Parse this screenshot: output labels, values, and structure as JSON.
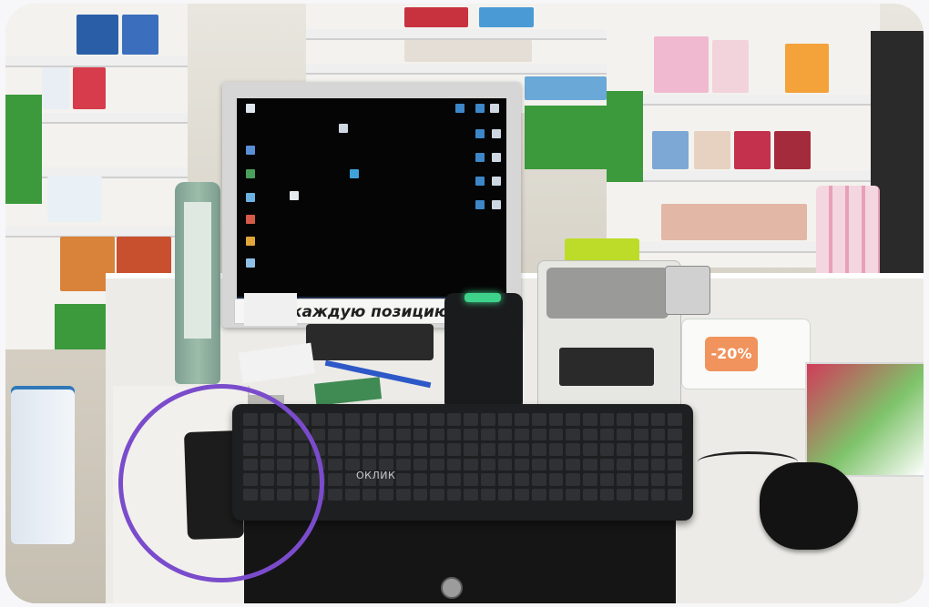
{
  "scene": {
    "sign_text": "П          м каждую позицию!!!",
    "keyboard_brand": "ОКЛИК",
    "tray_badge": "-20%"
  },
  "colors": {
    "annotation_circle": "#7a4ccc",
    "scanner_led": "#3ed18a",
    "pharmacy_green": "#3c9a3c"
  },
  "icons": {
    "desktop": [
      "file-icon",
      "folder-icon",
      "app-icon"
    ]
  }
}
